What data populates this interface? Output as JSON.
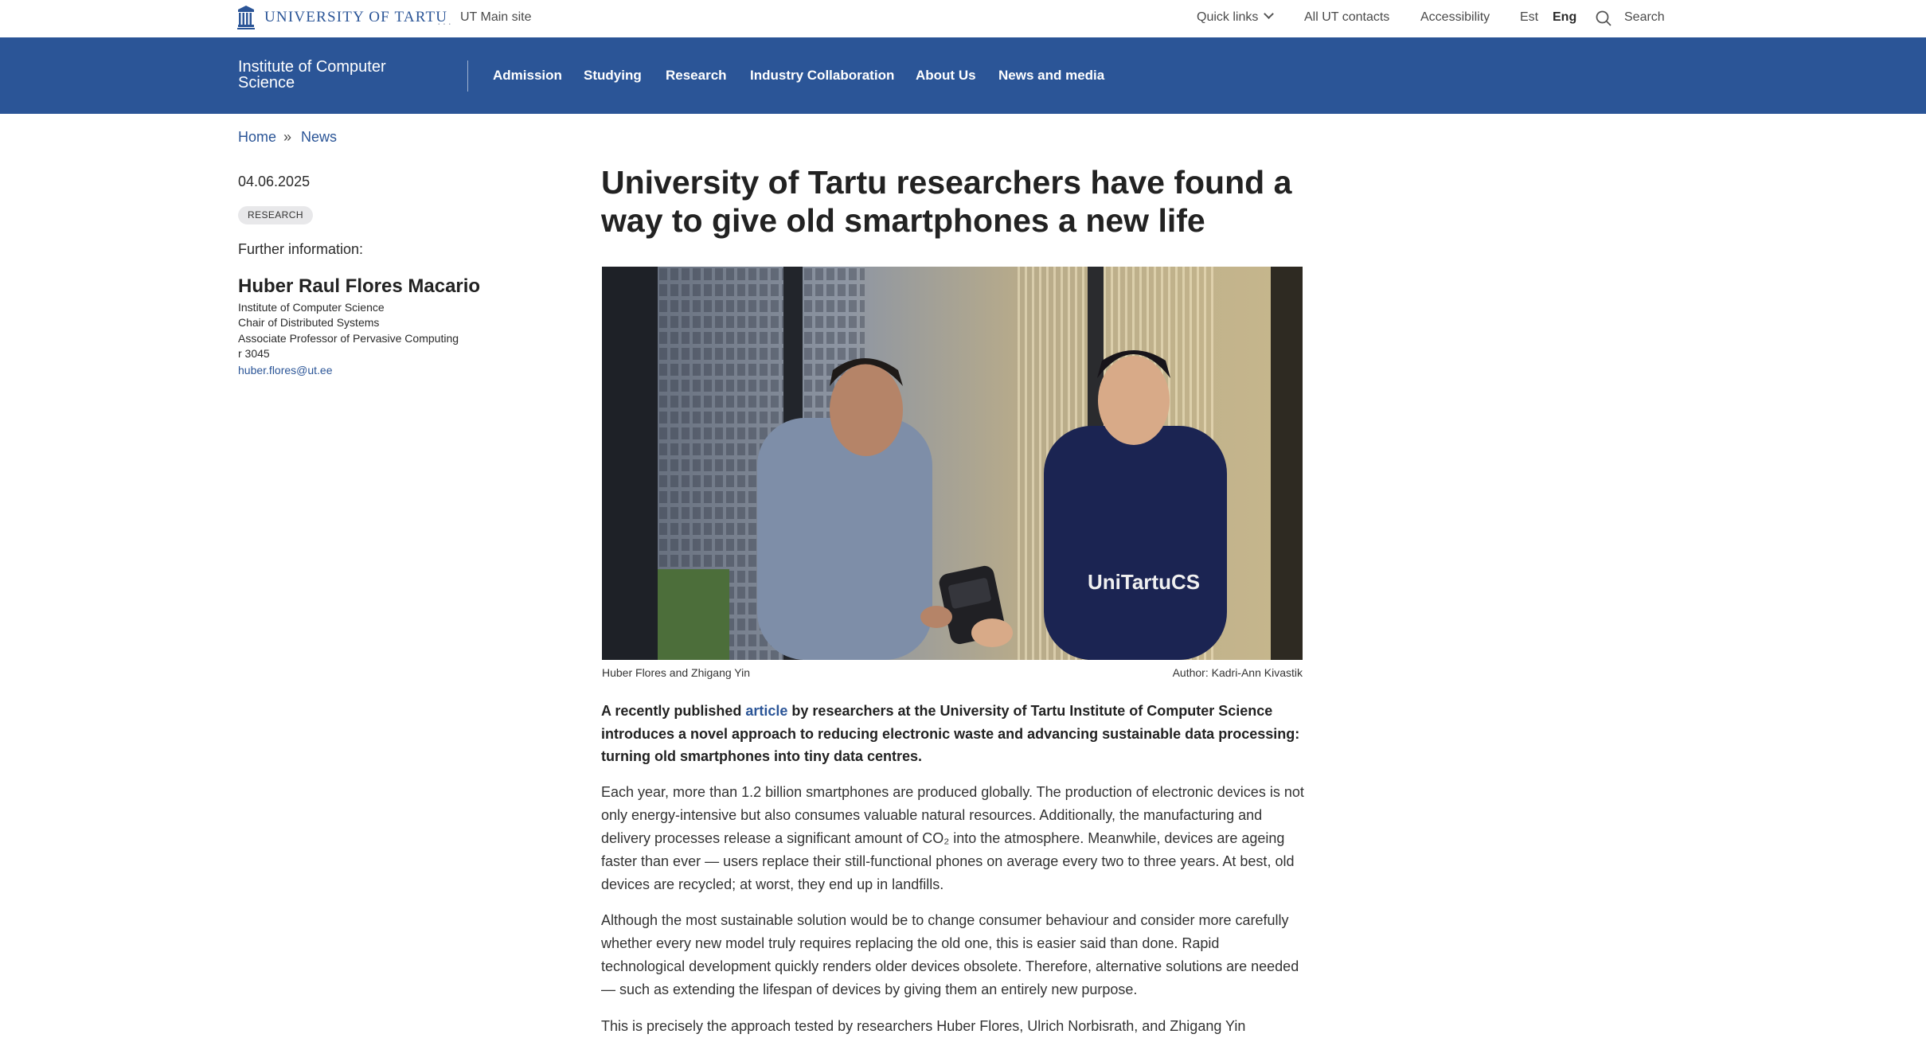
{
  "topbar": {
    "logo_text": "UNIVERSITY OF TARTU",
    "dots": "···",
    "main_site": "UT Main site",
    "quick_links": "Quick links",
    "contacts": "All UT contacts",
    "accessibility": "Accessibility",
    "lang_est": "Est",
    "lang_eng": "Eng",
    "search": "Search"
  },
  "navbar": {
    "institute": "Institute of Computer Science",
    "items": [
      "Admission",
      "Studying",
      "Research",
      "Industry Collaboration",
      "About Us",
      "News and media"
    ]
  },
  "breadcrumb": {
    "home": "Home",
    "separator": "»",
    "news": "News"
  },
  "sidebar": {
    "date": "04.06.2025",
    "tag": "RESEARCH",
    "further_label": "Further information:",
    "person": {
      "name": "Huber Raul Flores Macario",
      "lines": [
        "Institute of Computer Science",
        "Chair of Distributed Systems",
        "Associate Professor of Pervasive Computing",
        "r 3045"
      ],
      "email": "huber.flores@ut.ee"
    }
  },
  "article": {
    "title": "University of Tartu researchers have found a way to give old smartphones a new life",
    "image": {
      "shirt_text": "UniTartuCS"
    },
    "caption": "Huber Flores and Zhigang Yin",
    "credit": "Author: Kadri-Ann Kivastik",
    "lead_before": "A recently published ",
    "lead_link": "article",
    "lead_after": " by researchers at the University of Tartu Institute of Computer Science introduces a novel approach to reducing electronic waste and advancing sustainable data processing: turning old smartphones into tiny data centres.",
    "paragraphs": [
      "Each year, more than 1.2 billion smartphones are produced globally. The production of electronic devices is not only energy-intensive but also consumes valuable natural resources. Additionally, the manufacturing and delivery processes release a significant amount of CO₂ into the atmosphere. Meanwhile, devices are ageing faster than ever — users replace their still-functional phones on average every two to three years. At best, old devices are recycled; at worst, they end up in landfills.",
      "Although the most sustainable solution would be to change consumer behaviour and consider more carefully whether every new model truly requires replacing the old one, this is easier said than done. Rapid technological development quickly renders older devices obsolete. Therefore, alternative solutions are needed — such as extending the lifespan of devices by giving them an entirely new purpose.",
      "This is precisely the approach tested by researchers Huber Flores, Ulrich Norbisrath, and Zhigang Yin"
    ]
  },
  "colors": {
    "brand_blue": "#2b5597",
    "tag_bg": "#e8e8ea"
  }
}
